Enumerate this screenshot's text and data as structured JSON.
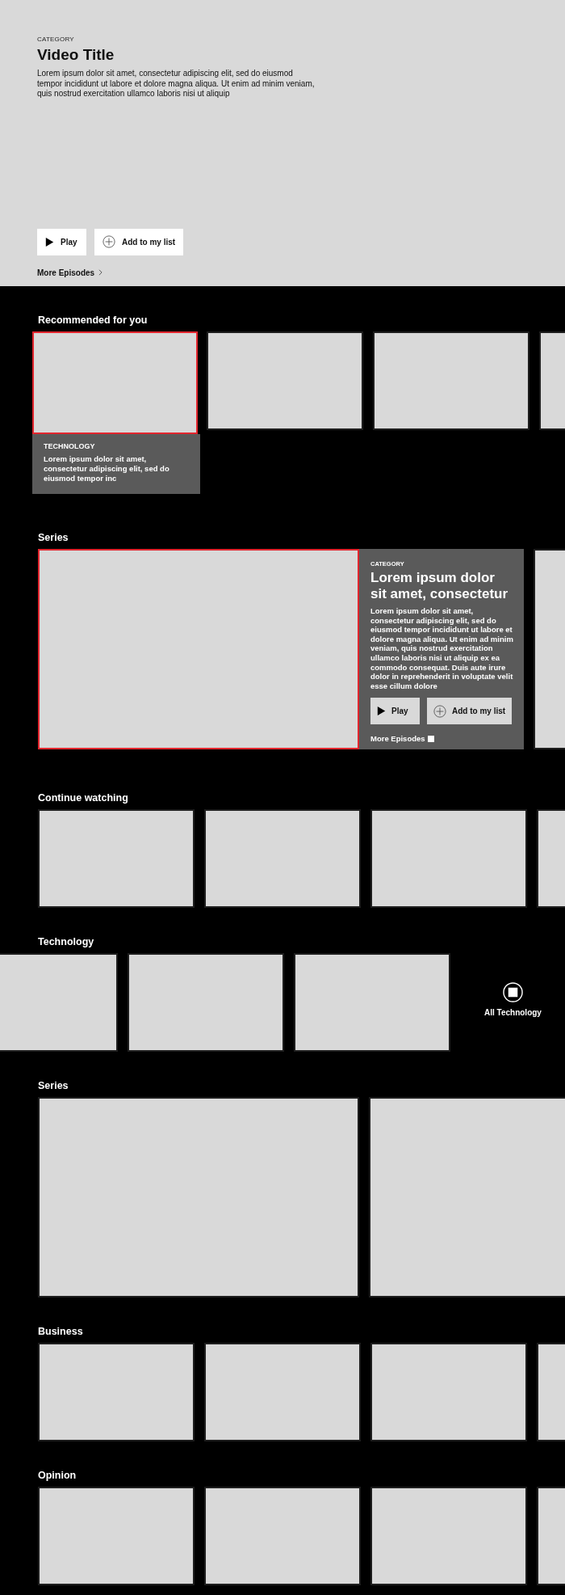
{
  "hero": {
    "category": "CATEGORY",
    "title": "Video Title",
    "description": "Lorem ipsum dolor sit amet, consectetur adipiscing elit, sed do eiusmod tempor incididunt ut labore et dolore magna aliqua. Ut enim ad minim veniam, quis nostrud exercitation ullamco laboris nisi ut aliquip",
    "buttons": [
      {
        "kind": "play",
        "label": "Play"
      },
      {
        "kind": "add",
        "label": "Add to my list"
      }
    ],
    "more_link": "More Episodes"
  },
  "rows": [
    {
      "kind": "cards",
      "title": "Recommended for you",
      "cards": [
        {
          "selected": true,
          "category": "TECHNOLOGY",
          "description": "Lorem ipsum dolor sit amet, consectetur adipiscing elit, sed do eiusmod tempor inc"
        },
        {
          "selected": false
        },
        {
          "selected": false
        },
        {
          "selected": false
        }
      ]
    },
    {
      "kind": "feature",
      "title": "Series",
      "cards": [
        {
          "selected": true,
          "details": {
            "category": "CATEGORY",
            "title": "Lorem ipsum dolor sit amet, consectetur",
            "description": "Lorem ipsum dolor sit amet, consectetur adipiscing elit, sed do eiusmod tempor incididunt ut labore et dolore magna aliqua. Ut enim ad minim veniam, quis nostrud exercitation ullamco laboris nisi ut aliquip ex ea commodo consequat. Duis aute irure dolor in reprehenderit in voluptate velit esse cillum dolore",
            "buttons": [
              {
                "kind": "play",
                "label": "Play"
              },
              {
                "kind": "add",
                "label": "Add to my list"
              }
            ],
            "more_link": "More Episodes"
          }
        },
        {
          "selected": false
        }
      ]
    },
    {
      "kind": "cards",
      "title": "Continue watching",
      "cards": [
        {
          "selected": false
        },
        {
          "selected": false
        },
        {
          "selected": false
        },
        {
          "selected": false
        }
      ]
    },
    {
      "kind": "offset",
      "title": "Technology",
      "cards": [
        {
          "selected": false
        },
        {
          "selected": false
        },
        {
          "selected": false
        }
      ],
      "more_link": "All Technology"
    },
    {
      "kind": "wide",
      "title": "Series",
      "cards": [
        {
          "selected": false
        },
        {
          "selected": false
        }
      ]
    },
    {
      "kind": "cards",
      "title": "Business",
      "cards": [
        {
          "selected": false
        },
        {
          "selected": false
        },
        {
          "selected": false
        },
        {
          "selected": false
        }
      ]
    },
    {
      "kind": "cards",
      "title": "Opinion",
      "cards": [
        {
          "selected": false
        },
        {
          "selected": false
        },
        {
          "selected": false
        },
        {
          "selected": false
        }
      ]
    }
  ]
}
